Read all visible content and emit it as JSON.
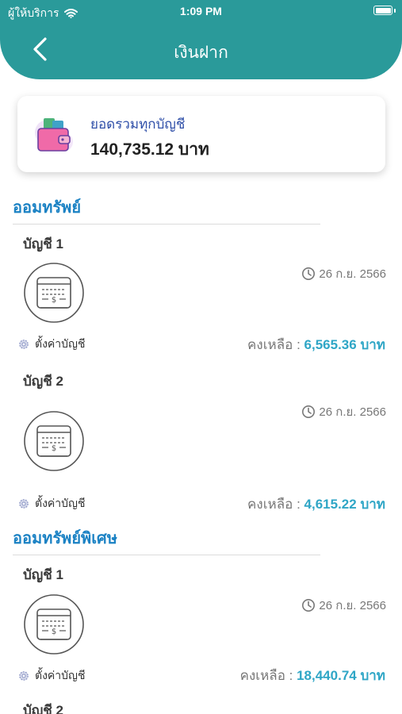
{
  "status_bar": {
    "carrier": "ผู้ให้บริการ",
    "time": "1:09 PM"
  },
  "header": {
    "title": "เงินฝาก"
  },
  "total": {
    "label": "ยอดรวมทุกบัญชี",
    "value": "140,735.12 บาท"
  },
  "sections": [
    {
      "title": "ออมทรัพย์",
      "accounts": [
        {
          "name": "บัญชี 1",
          "date": "26 ก.ย. 2566",
          "setting_label": "ตั้งค่าบัญชี",
          "balance_label": "คงเหลือ :",
          "balance": "6,565.36 บาท"
        },
        {
          "name": "บัญชี 2",
          "date": "26 ก.ย. 2566",
          "setting_label": "ตั้งค่าบัญชี",
          "balance_label": "คงเหลือ :",
          "balance": "4,615.22 บาท"
        }
      ]
    },
    {
      "title": "ออมทรัพย์พิเศษ",
      "accounts": [
        {
          "name": "บัญชี 1",
          "date": "26 ก.ย. 2566",
          "setting_label": "ตั้งค่าบัญชี",
          "balance_label": "คงเหลือ :",
          "balance": "18,440.74 บาท"
        },
        {
          "name": "บัญชี 2"
        }
      ]
    }
  ],
  "colors": {
    "header_bg": "#2a9a9a",
    "section_title": "#1b82c4",
    "balance_amount": "#2fa6c6",
    "total_label": "#2f4fa8"
  },
  "icons": [
    "wifi-icon",
    "battery-icon",
    "back-chevron-icon",
    "wallet-icon",
    "clock-icon",
    "atm-icon",
    "gear-icon"
  ]
}
